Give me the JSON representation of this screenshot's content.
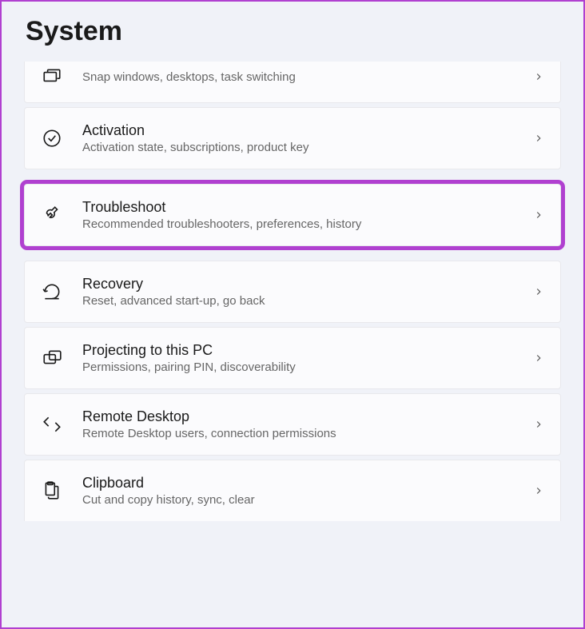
{
  "page": {
    "title": "System"
  },
  "items": [
    {
      "title": "",
      "description": "Snap windows, desktops, task switching",
      "partial": "top"
    },
    {
      "title": "Activation",
      "description": "Activation state, subscriptions, product key"
    },
    {
      "title": "Troubleshoot",
      "description": "Recommended troubleshooters, preferences, history",
      "highlighted": true
    },
    {
      "title": "Recovery",
      "description": "Reset, advanced start-up, go back"
    },
    {
      "title": "Projecting to this PC",
      "description": "Permissions, pairing PIN, discoverability"
    },
    {
      "title": "Remote Desktop",
      "description": "Remote Desktop users, connection permissions"
    },
    {
      "title": "Clipboard",
      "description": "Cut and copy history, sync, clear",
      "partial": "bottom"
    }
  ]
}
